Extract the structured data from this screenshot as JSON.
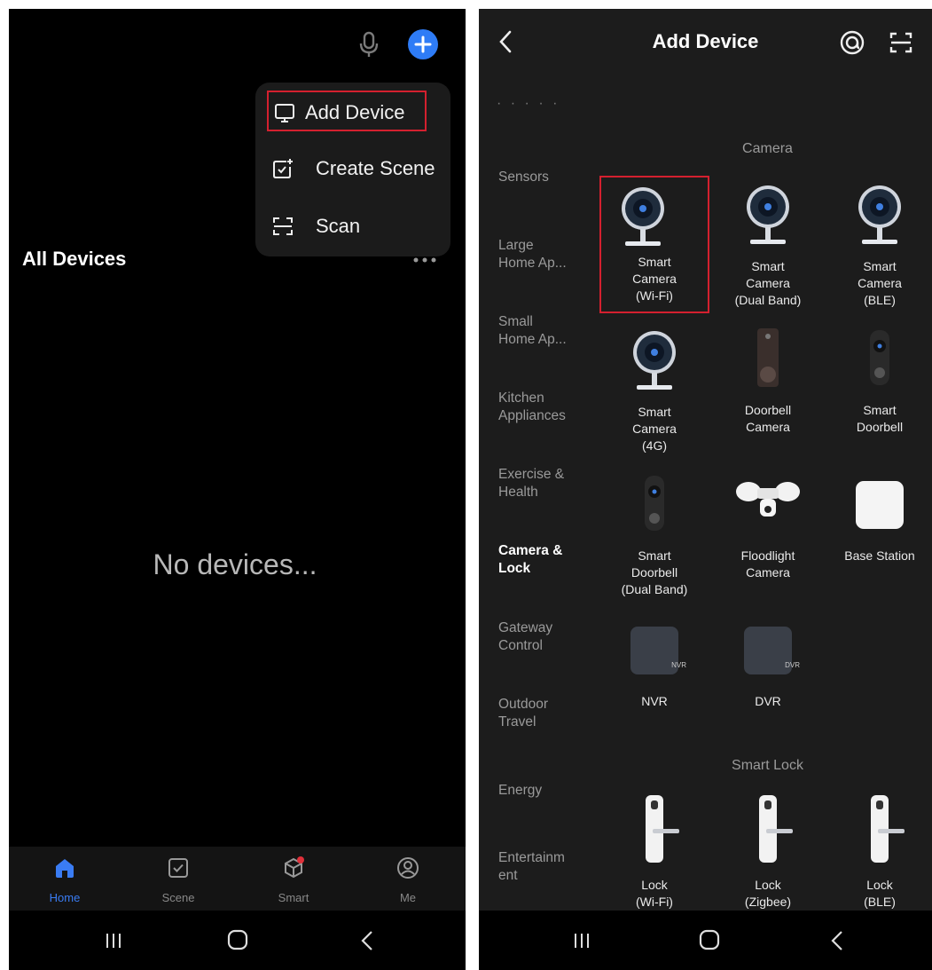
{
  "left": {
    "menu": {
      "add_device": "Add Device",
      "create_scene": "Create Scene",
      "scan": "Scan"
    },
    "section_title": "All Devices",
    "empty_message": "No devices...",
    "tabs": [
      {
        "label": "Home",
        "icon": "home-icon",
        "active": true
      },
      {
        "label": "Scene",
        "icon": "checkbox-icon",
        "active": false
      },
      {
        "label": "Smart",
        "icon": "smart-cube-icon",
        "active": false
      },
      {
        "label": "Me",
        "icon": "profile-icon",
        "active": false
      }
    ],
    "accent": "#2e7cf6",
    "highlight": "#d4202f"
  },
  "right": {
    "title": "Add Device",
    "categories": [
      {
        "label": "Sensors",
        "active": false
      },
      {
        "label": "Large\nHome Ap...",
        "active": false
      },
      {
        "label": "Small\nHome Ap...",
        "active": false
      },
      {
        "label": "Kitchen\nAppliances",
        "active": false
      },
      {
        "label": "Exercise &\nHealth",
        "active": false
      },
      {
        "label": "Camera &\nLock",
        "active": true
      },
      {
        "label": "Gateway\nControl",
        "active": false
      },
      {
        "label": "Outdoor\nTravel",
        "active": false
      },
      {
        "label": "Energy",
        "active": false
      },
      {
        "label": "Entertainm\nent",
        "active": false
      }
    ],
    "sections": {
      "camera": "Camera",
      "smart_lock": "Smart Lock"
    },
    "devices": {
      "cam_wifi": "Smart\nCamera\n(Wi-Fi)",
      "cam_dual": "Smart\nCamera\n(Dual Band)",
      "cam_ble": "Smart\nCamera\n(BLE)",
      "cam_4g": "Smart\nCamera\n(4G)",
      "doorbell_camera": "Doorbell\nCamera",
      "smart_doorbell": "Smart\nDoorbell",
      "doorbell_dual": "Smart\nDoorbell\n(Dual Band)",
      "floodlight": "Floodlight\nCamera",
      "base_station": "Base Station",
      "nvr": "NVR",
      "nvr_badge": "NVR",
      "dvr": "DVR",
      "dvr_badge": "DVR",
      "lock_wifi": "Lock\n(Wi-Fi)",
      "lock_zigbee": "Lock\n(Zigbee)",
      "lock_ble": "Lock\n(BLE)"
    }
  }
}
